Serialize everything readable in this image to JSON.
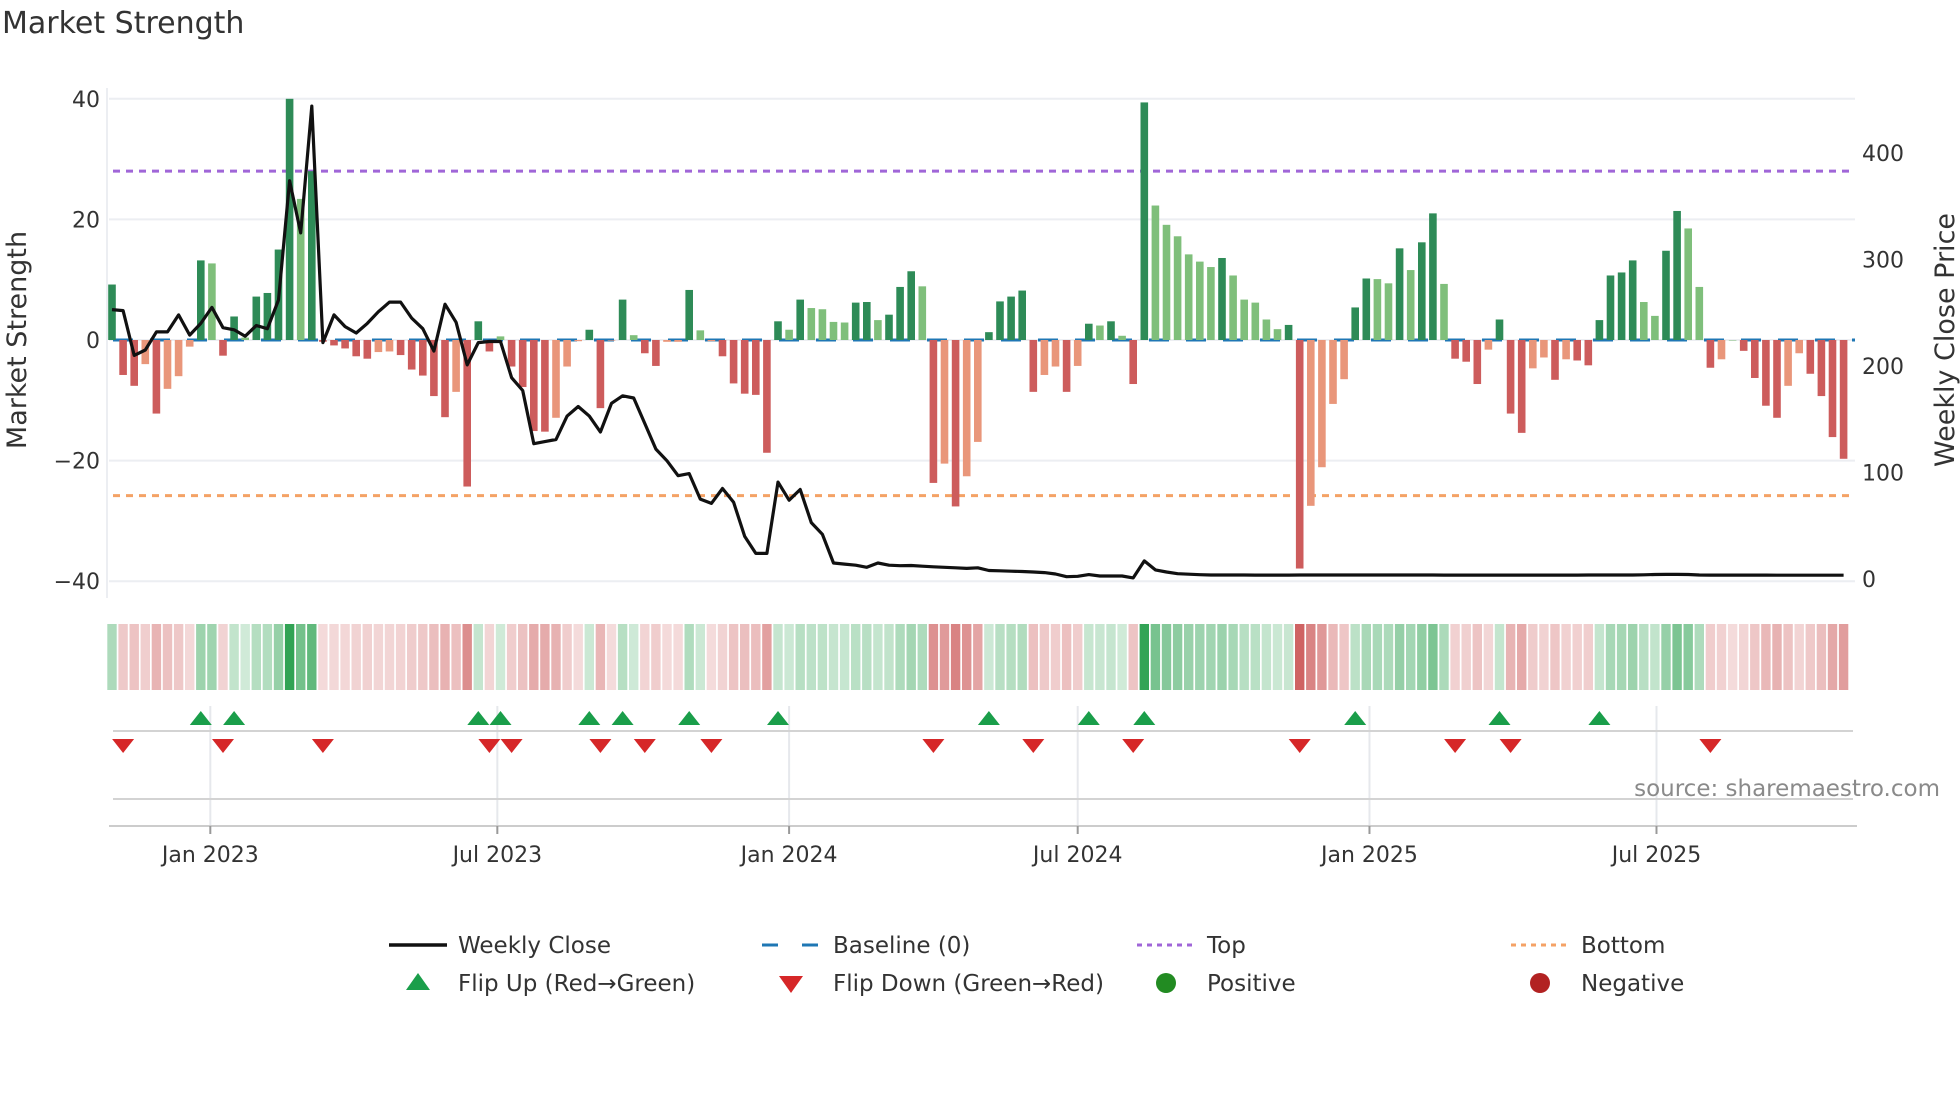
{
  "title": "Market Strength",
  "source": "source: sharemaestro.com",
  "chart_data": {
    "type": "bar",
    "title": "Market Strength",
    "ylabel": "Market Strength",
    "y2label": "Weekly Close Price",
    "ylim": [
      -42,
      42
    ],
    "y2lim": [
      -5,
      440
    ],
    "x_start": "2022-10-31",
    "x_freq": "weekly",
    "yticks": [
      "40",
      "20",
      "0",
      "−20",
      "−40"
    ],
    "ytick_values": [
      40,
      20,
      0,
      -20,
      -40
    ],
    "y2ticks": [
      "400",
      "300",
      "200",
      "100",
      "0"
    ],
    "y2tick_values": [
      400,
      300,
      200,
      100,
      0
    ],
    "xticks": [
      {
        "label": "Jan 2023",
        "date": "2023-01-01"
      },
      {
        "label": "Jul 2023",
        "date": "2023-07-01"
      },
      {
        "label": "Jan 2024",
        "date": "2024-01-01"
      },
      {
        "label": "Jul 2024",
        "date": "2024-07-01"
      },
      {
        "label": "Jan 2025",
        "date": "2025-01-01"
      },
      {
        "label": "Jul 2025",
        "date": "2025-07-01"
      }
    ],
    "top_level": 28,
    "bottom_level": -25.8,
    "baseline": 0,
    "strength": [
      9.2,
      -5.8,
      -7.6,
      -4.0,
      -12.2,
      -8.1,
      -6.0,
      -1.1,
      13.2,
      12.7,
      -2.6,
      3.9,
      0.4,
      7.2,
      7.8,
      15.0,
      40.0,
      23.4,
      28.0,
      -0.3,
      -0.9,
      -1.4,
      -2.7,
      -3.1,
      -2.0,
      -1.9,
      -2.5,
      -4.9,
      -5.9,
      -9.3,
      -12.8,
      -8.6,
      -24.3,
      3.1,
      -1.9,
      0.6,
      -4.4,
      -7.8,
      -15.1,
      -15.2,
      -12.9,
      -4.4,
      -0.2,
      1.7,
      -11.3,
      -0.1,
      6.7,
      0.8,
      -2.2,
      -4.3,
      -0.3,
      -0.3,
      8.3,
      1.6,
      -0.2,
      -2.7,
      -7.2,
      -8.9,
      -9.1,
      -18.7,
      3.1,
      1.7,
      6.7,
      5.3,
      5.1,
      3.0,
      2.9,
      6.2,
      6.3,
      3.3,
      4.2,
      8.8,
      11.4,
      8.9,
      -23.7,
      -20.5,
      -27.6,
      -22.6,
      -16.9,
      1.3,
      6.4,
      7.2,
      8.2,
      -8.6,
      -5.8,
      -4.4,
      -8.6,
      -4.3,
      2.7,
      2.4,
      3.1,
      0.7,
      -7.3,
      39.4,
      22.3,
      19.1,
      17.2,
      14.2,
      13.0,
      12.1,
      13.6,
      10.7,
      6.7,
      6.2,
      3.4,
      1.8,
      2.5,
      -37.9,
      -27.5,
      -21.1,
      -10.6,
      -6.5,
      5.4,
      10.2,
      10.1,
      9.4,
      15.2,
      11.6,
      16.2,
      21.0,
      9.3,
      -3.1,
      -3.6,
      -7.3,
      -1.6,
      3.4,
      -12.2,
      -15.4,
      -4.7,
      -2.9,
      -6.6,
      -3.2,
      -3.4,
      -4.2,
      3.3,
      10.7,
      11.2,
      13.2,
      6.3,
      4.0,
      14.8,
      21.4,
      18.5,
      8.8,
      -4.6,
      -3.2,
      0,
      -1.8,
      -6.3,
      -10.9,
      -12.9,
      -7.6,
      -2.2,
      -5.6,
      -9.3,
      -16.1,
      -19.7
    ],
    "strength_tone": "DDDLDLLLDLDDLDDDDLDDDDDDLLDDDDDLDDDLDDDDLLLDDLDLDDLLDLLDDDDDDLDLLLLDDLDDDLDLDLLDDDDDLLDLDLDLDDLLLLLLDLLLLLDDLLLLDDLLDLDDLDDDLDDDLLDLDDDDDDLLDDLLDLLDDDDLLDDDD",
    "weekly_close": [
      253,
      252,
      210,
      215,
      232,
      232,
      248,
      229,
      240,
      255,
      236,
      234,
      228,
      238,
      235,
      262,
      374,
      325,
      444,
      222,
      248,
      237,
      231,
      240,
      251,
      260,
      260,
      245,
      235,
      214,
      258,
      241,
      201,
      222,
      223,
      223,
      189,
      177,
      127,
      129,
      131,
      153,
      162,
      153,
      138,
      165,
      172,
      170,
      146,
      122,
      111,
      97,
      99,
      75,
      71,
      85,
      72,
      40,
      24,
      24,
      91,
      74,
      84,
      53,
      42,
      15,
      14,
      13,
      11,
      15,
      13,
      12.5,
      12.7,
      12,
      11.5,
      11,
      10.5,
      10,
      10.5,
      8,
      7.7,
      7.3,
      7,
      6.6,
      6,
      4.7,
      2.2,
      2.5,
      4.1,
      2.8,
      2.8,
      2.8,
      1,
      17,
      8.5,
      6.6,
      5,
      4.5,
      4,
      3.8,
      3.8,
      3.8,
      3.8,
      3.7,
      3.7,
      3.7,
      3.7,
      3.8,
      3.8,
      3.8,
      3.8,
      3.8,
      3.8,
      3.8,
      3.8,
      3.8,
      3.8,
      3.8,
      3.8,
      3.8,
      3.7,
      3.7,
      3.7,
      3.7,
      3.7,
      3.7,
      3.7,
      3.7,
      3.7,
      3.7,
      3.7,
      3.7,
      3.7,
      3.8,
      3.8,
      3.8,
      3.8,
      3.8,
      3.9,
      4.2,
      4.3,
      4.3,
      4.2,
      3.8,
      3.7,
      3.7,
      3.7,
      3.7,
      3.7,
      3.7,
      3.6,
      3.6,
      3.6,
      3.6,
      3.6,
      3.6,
      3.6
    ],
    "flip_up_weeks": [
      9,
      12,
      34,
      36,
      44,
      47,
      53,
      61,
      80,
      89,
      94,
      113,
      126,
      135
    ],
    "flip_down_weeks": [
      2,
      11,
      20,
      35,
      37,
      45,
      49,
      55,
      75,
      84,
      93,
      108,
      122,
      127,
      145
    ],
    "colors": {
      "pos_dark": "#2e8b57",
      "pos_light": "#7fbf7b",
      "neg_dark": "#cd5c5c",
      "neg_light": "#e9967a",
      "baseline": "#1f77b4",
      "top": "#a066d8",
      "bottom": "#f4a266",
      "close": "#111111",
      "flip_up": "#1a9e4a",
      "flip_down": "#d62728",
      "positive": "#228b22",
      "negative": "#b22222"
    },
    "legend": [
      {
        "label": "Weekly Close",
        "kind": "line"
      },
      {
        "label": "Baseline (0)",
        "kind": "baseline"
      },
      {
        "label": "Top",
        "kind": "top"
      },
      {
        "label": "Bottom",
        "kind": "bottom"
      },
      {
        "label": "Flip Up (Red→Green)",
        "kind": "up"
      },
      {
        "label": "Flip Down (Green→Red)",
        "kind": "down"
      },
      {
        "label": "Positive",
        "kind": "pos"
      },
      {
        "label": "Negative",
        "kind": "neg"
      }
    ],
    "legend_placement": "bottom-center"
  }
}
